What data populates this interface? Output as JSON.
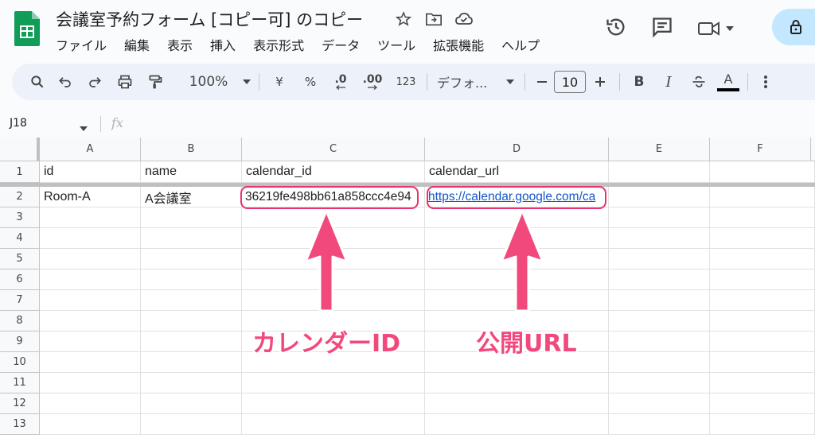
{
  "header": {
    "title": "会議室予約フォーム [コピー可] のコピー",
    "menu": [
      "ファイル",
      "編集",
      "表示",
      "挿入",
      "表示形式",
      "データ",
      "ツール",
      "拡張機能",
      "ヘルプ"
    ]
  },
  "toolbar": {
    "zoom": "100%",
    "currency": "¥",
    "percent": "%",
    "decimal_decrease": ".0",
    "decimal_increase": ".00",
    "number_format": "123",
    "font": "デフォ...",
    "font_size": "10",
    "bold": "B",
    "italic": "I",
    "text_color": "A"
  },
  "formula_bar": {
    "name_box": "J18",
    "fx": "fx"
  },
  "sheet": {
    "columns": [
      "A",
      "B",
      "C",
      "D",
      "E",
      "F"
    ],
    "rows": [
      "1",
      "2",
      "3",
      "4",
      "5",
      "6",
      "7",
      "8",
      "9",
      "10",
      "11",
      "12",
      "13"
    ],
    "cells": {
      "A1": "id",
      "B1": "name",
      "C1": "calendar_id",
      "D1": "calendar_url",
      "A2": "Room-A",
      "B2": "A会議室",
      "C2": "36219fe498bb61a858ccc4e94",
      "D2": "https://calendar.google.com/ca"
    }
  },
  "annotations": {
    "calendar_id_label": "カレンダーID",
    "public_url_label": "公開URL",
    "color": "#f2497c"
  },
  "colors": {
    "accent": "#e8336d",
    "link": "#1155cc",
    "share_button": "#c2e7ff"
  }
}
